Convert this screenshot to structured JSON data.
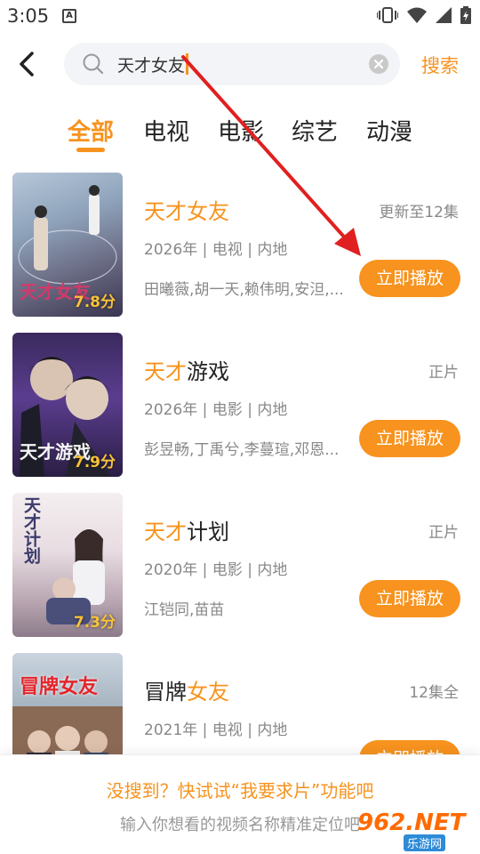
{
  "status_bar": {
    "time": "3:05",
    "notification_icon": "A"
  },
  "search": {
    "query": "天才女友",
    "button_label": "搜索"
  },
  "tabs": [
    {
      "label": "全部",
      "active": true
    },
    {
      "label": "电视",
      "active": false
    },
    {
      "label": "电影",
      "active": false
    },
    {
      "label": "综艺",
      "active": false
    },
    {
      "label": "动漫",
      "active": false
    }
  ],
  "results": [
    {
      "title_highlight": "天才女友",
      "title_rest": "",
      "title_prefix": "",
      "status": "更新至12集",
      "meta": "2026年 | 电视 | 内地",
      "cast": "田曦薇,胡一天,赖伟明,安泹,...",
      "rating": "7.8分",
      "play_label": "立即播放"
    },
    {
      "title_highlight": "天才",
      "title_rest": "游戏",
      "title_prefix": "",
      "status": "正片",
      "meta": "2026年 | 电影 | 内地",
      "cast": "彭昱畅,丁禹兮,李蔓瑄,邓恩...",
      "rating": "7.9分",
      "play_label": "立即播放"
    },
    {
      "title_highlight": "天才",
      "title_rest": "计划",
      "title_prefix": "",
      "status": "正片",
      "meta": "2020年 | 电影 | 内地",
      "cast": "江铠同,苗苗",
      "rating": "7.3分",
      "play_label": "立即播放"
    },
    {
      "title_highlight": "女友",
      "title_rest": "",
      "title_prefix": "冒牌",
      "status": "12集全",
      "meta": "2021年 | 电视 | 内地",
      "cast": "",
      "rating": "",
      "play_label": "立即播放"
    }
  ],
  "poster_texts": [
    "天才女友",
    "天才游戏",
    "天才计划",
    "冒牌女友"
  ],
  "footer": {
    "title": "没搜到？快试试“我要求片”功能吧",
    "subtitle": "输入你想看的视频名称精准定位吧"
  },
  "watermark": {
    "main": "962.NET",
    "sub": "乐游网"
  },
  "colors": {
    "accent": "#f7931e",
    "annotation_arrow": "#e02020"
  }
}
